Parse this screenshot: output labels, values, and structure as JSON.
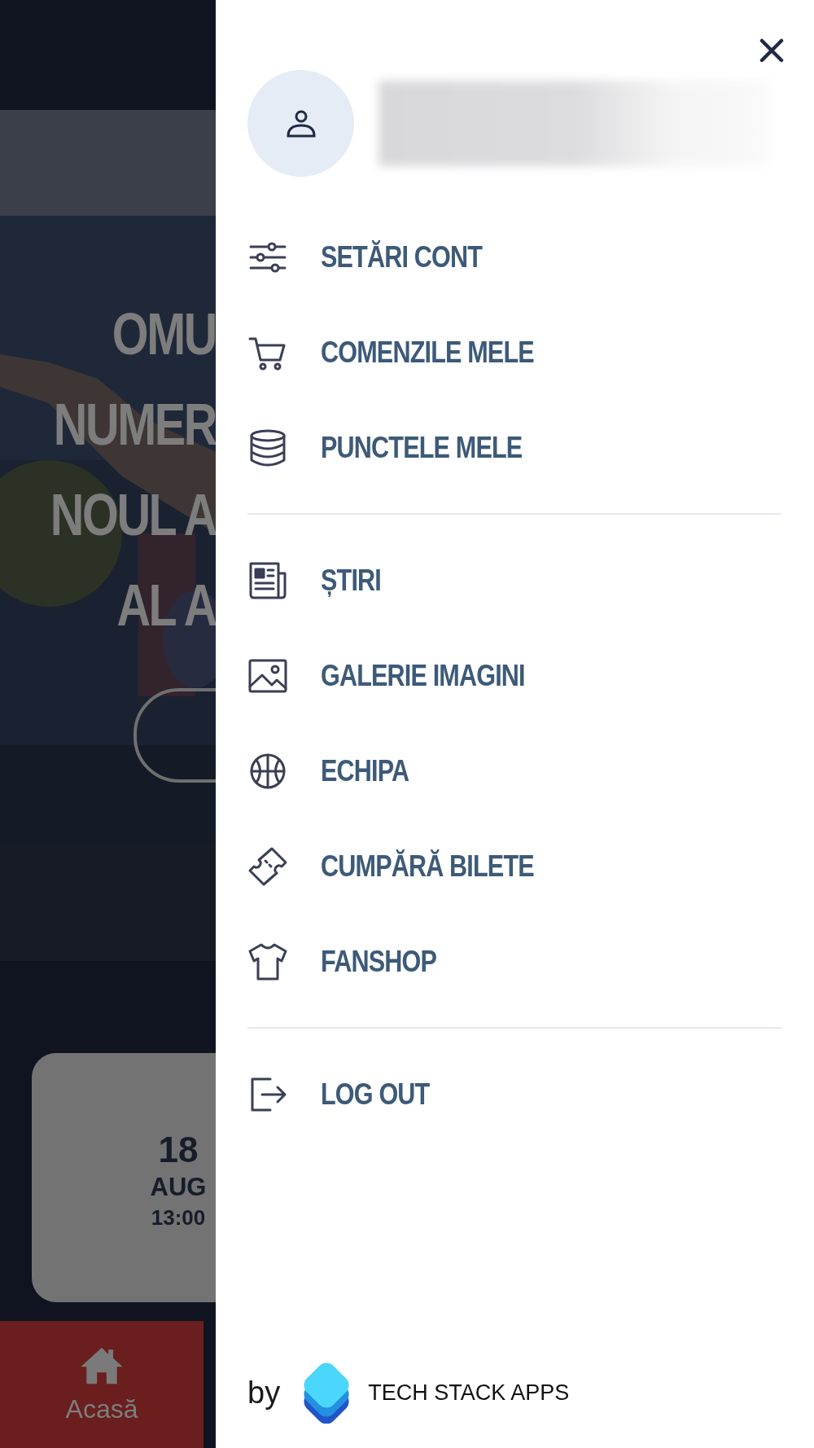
{
  "background": {
    "headline_lines": [
      "OMU",
      "NUMER",
      "NOUL A",
      "AL A"
    ],
    "event_card": {
      "day": "18",
      "month": "AUG",
      "time": "13:00"
    },
    "bottom_nav": [
      {
        "label": "Acasă",
        "selected": true
      }
    ]
  },
  "drawer": {
    "sections": [
      [
        {
          "label": "SETĂRI CONT"
        },
        {
          "label": "COMENZILE MELE"
        },
        {
          "label": "PUNCTELE MELE"
        }
      ],
      [
        {
          "label": "ȘTIRI"
        },
        {
          "label": "GALERIE IMAGINI"
        },
        {
          "label": "ECHIPA"
        },
        {
          "label": "CUMPĂRĂ BILETE"
        },
        {
          "label": "FANSHOP"
        }
      ],
      [
        {
          "label": "LOG OUT"
        }
      ]
    ],
    "footer": {
      "by": "by",
      "brand": "TECH STACK APPS"
    }
  }
}
